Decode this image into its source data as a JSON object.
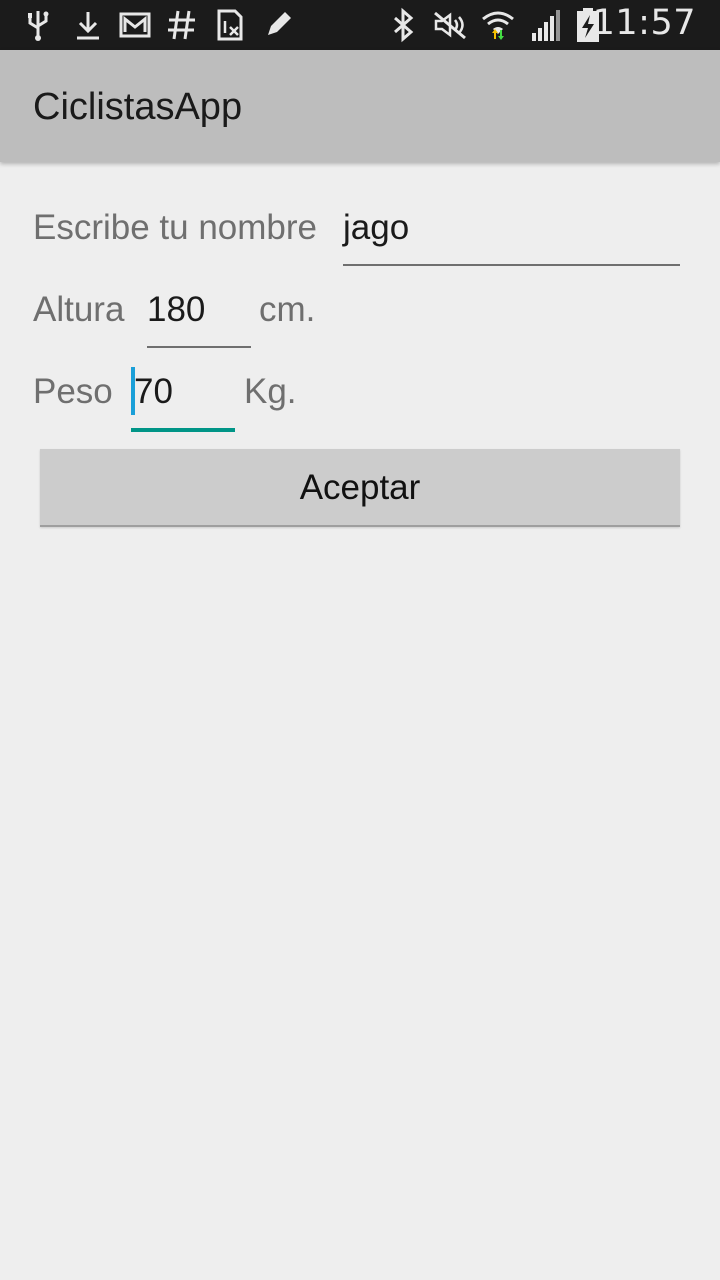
{
  "status_bar": {
    "left_icons": [
      "usb-icon",
      "download-icon",
      "gmail-icon",
      "hashtag-icon",
      "sim-icon",
      "pencil-icon"
    ],
    "right_icons": [
      "bluetooth-icon",
      "mute-icon",
      "wifi-icon",
      "signal-icon",
      "battery-charging-icon"
    ],
    "time": "11:57"
  },
  "action_bar": {
    "title": "CiclistasApp"
  },
  "form": {
    "name_label": "Escribe tu nombre",
    "name_value": "jago",
    "height_label": "Altura",
    "height_value": "180",
    "height_unit": "cm.",
    "weight_label": "Peso",
    "weight_value": "70",
    "weight_unit": "Kg.",
    "accept_label": "Aceptar"
  },
  "colors": {
    "focus_accent": "#009587",
    "cursor": "#1a9fd8",
    "action_bar": "#bdbdbd",
    "background": "#eeeeee"
  }
}
